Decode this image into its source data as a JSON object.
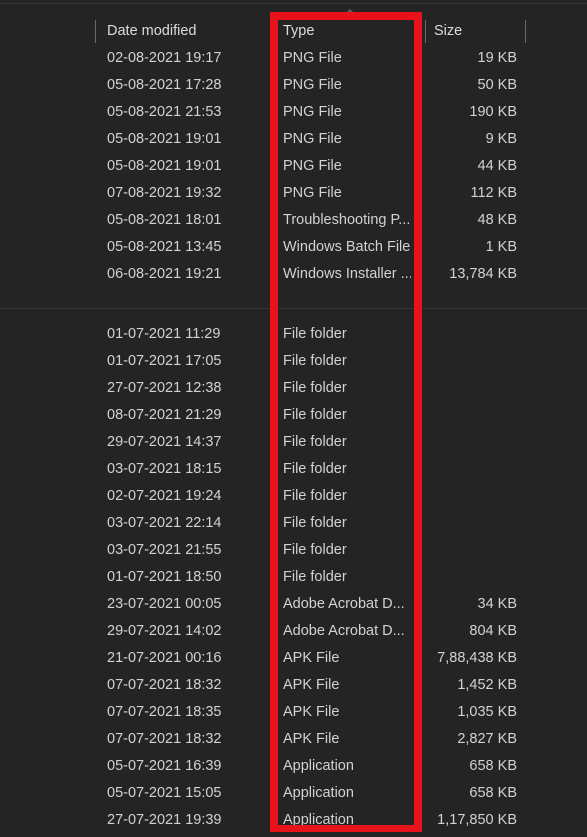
{
  "window": {
    "theme": "dark",
    "background_color": "#242424",
    "text_color": "#d2d2d2",
    "highlight_color": "#e8131a"
  },
  "columns": {
    "date_modified": "Date modified",
    "type": "Type",
    "size": "Size",
    "sorted_by": "Type",
    "sort_direction": "ascending"
  },
  "groups": [
    {
      "rows": [
        {
          "date": "02-08-2021 19:17",
          "type": "PNG File",
          "size": "19 KB"
        },
        {
          "date": "05-08-2021 17:28",
          "type": "PNG File",
          "size": "50 KB"
        },
        {
          "date": "05-08-2021 21:53",
          "type": "PNG File",
          "size": "190 KB"
        },
        {
          "date": "05-08-2021 19:01",
          "type": "PNG File",
          "size": "9 KB"
        },
        {
          "date": "05-08-2021 19:01",
          "type": "PNG File",
          "size": "44 KB"
        },
        {
          "date": "07-08-2021 19:32",
          "type": "PNG File",
          "size": "112 KB"
        },
        {
          "date": "05-08-2021 18:01",
          "type": "Troubleshooting P...",
          "size": "48 KB"
        },
        {
          "date": "05-08-2021 13:45",
          "type": "Windows Batch File",
          "size": "1 KB"
        },
        {
          "date": "06-08-2021 19:21",
          "type": "Windows Installer ...",
          "size": "13,784 KB"
        }
      ]
    },
    {
      "rows": [
        {
          "date": "01-07-2021 11:29",
          "type": "File folder",
          "size": ""
        },
        {
          "date": "01-07-2021 17:05",
          "type": "File folder",
          "size": ""
        },
        {
          "date": "27-07-2021 12:38",
          "type": "File folder",
          "size": ""
        },
        {
          "date": "08-07-2021 21:29",
          "type": "File folder",
          "size": ""
        },
        {
          "date": "29-07-2021 14:37",
          "type": "File folder",
          "size": ""
        },
        {
          "date": "03-07-2021 18:15",
          "type": "File folder",
          "size": ""
        },
        {
          "date": "02-07-2021 19:24",
          "type": "File folder",
          "size": ""
        },
        {
          "date": "03-07-2021 22:14",
          "type": "File folder",
          "size": ""
        },
        {
          "date": "03-07-2021 21:55",
          "type": "File folder",
          "size": ""
        },
        {
          "date": "01-07-2021 18:50",
          "type": "File folder",
          "size": ""
        },
        {
          "date": "23-07-2021 00:05",
          "type": "Adobe Acrobat D...",
          "size": "34 KB"
        },
        {
          "date": "29-07-2021 14:02",
          "type": "Adobe Acrobat D...",
          "size": "804 KB"
        },
        {
          "date": "21-07-2021 00:16",
          "type": "APK File",
          "size": "7,88,438 KB"
        },
        {
          "date": "07-07-2021 18:32",
          "type": "APK File",
          "size": "1,452 KB"
        },
        {
          "date": "07-07-2021 18:35",
          "type": "APK File",
          "size": "1,035 KB"
        },
        {
          "date": "07-07-2021 18:32",
          "type": "APK File",
          "size": "2,827 KB"
        },
        {
          "date": "05-07-2021 16:39",
          "type": "Application",
          "size": "658 KB"
        },
        {
          "date": "05-07-2021 15:05",
          "type": "Application",
          "size": "658 KB"
        },
        {
          "date": "27-07-2021 19:39",
          "type": "Application",
          "size": "1,17,850 KB"
        }
      ]
    }
  ]
}
